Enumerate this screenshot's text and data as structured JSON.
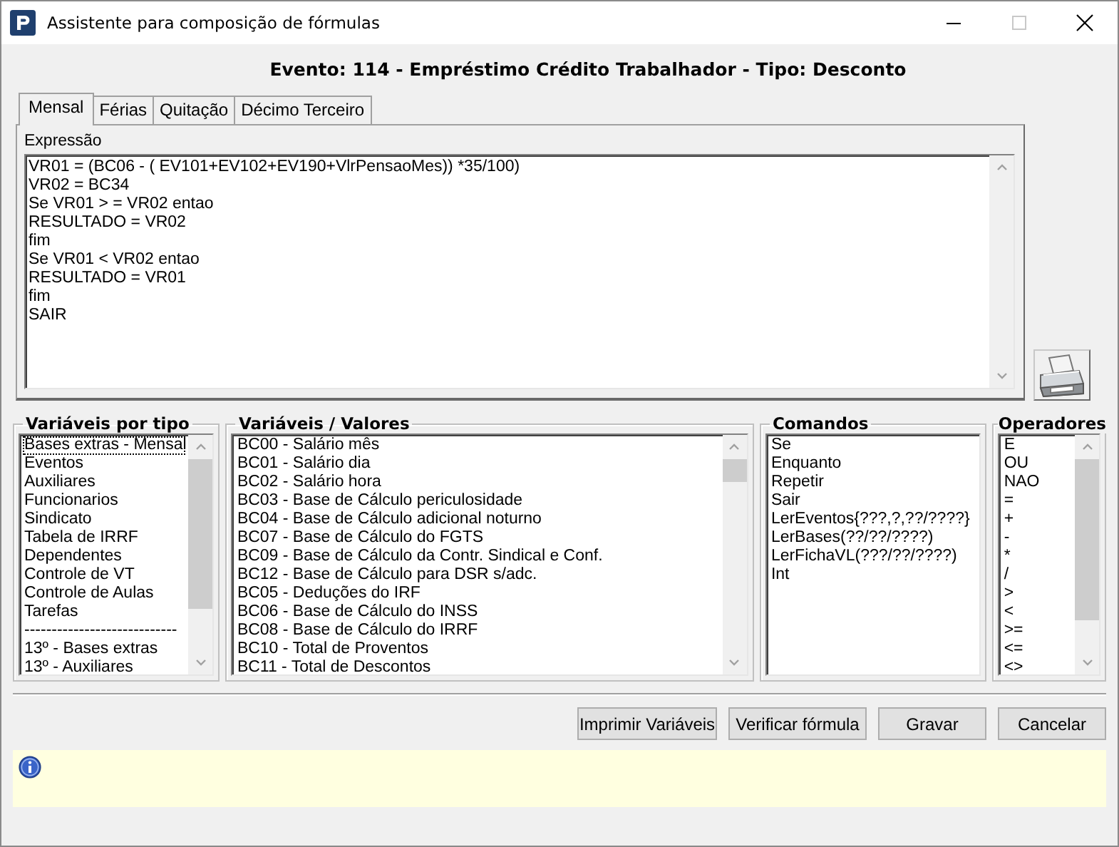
{
  "window": {
    "title": "Assistente para composição de fórmulas"
  },
  "header": "Evento: 114 - Empréstimo Crédito Trabalhador - Tipo: Desconto",
  "tabs": [
    {
      "label": "Mensal",
      "selected": true
    },
    {
      "label": "Férias",
      "selected": false
    },
    {
      "label": "Quitação",
      "selected": false
    },
    {
      "label": "Décimo Terceiro",
      "selected": false
    }
  ],
  "expression": {
    "label": "Expressão",
    "lines": [
      "VR01 = (BC06 - ( EV101+EV102+EV190+VlrPensaoMes)) *35/100)",
      "VR02 = BC34",
      "Se VR01 > = VR02 entao",
      "RESULTADO = VR02",
      "fim",
      "Se VR01 < VR02 entao",
      "RESULTADO = VR01",
      "fim",
      "SAIR"
    ]
  },
  "lists": [
    {
      "title": "Variáveis por tipo",
      "items": [
        {
          "label": "Bases extras - Mensal",
          "selected": true
        },
        {
          "label": "Eventos",
          "selected": false
        },
        {
          "label": "Auxiliares",
          "selected": false
        },
        {
          "label": "Funcionarios",
          "selected": false
        },
        {
          "label": "Sindicato",
          "selected": false
        },
        {
          "label": "Tabela de IRRF",
          "selected": false
        },
        {
          "label": "Dependentes",
          "selected": false
        },
        {
          "label": "Controle de VT",
          "selected": false
        },
        {
          "label": "Controle de Aulas",
          "selected": false
        },
        {
          "label": "Tarefas",
          "selected": false
        },
        {
          "label": "----------------------------",
          "selected": false
        },
        {
          "label": "13º - Bases extras",
          "selected": false
        },
        {
          "label": "13º - Auxiliares",
          "selected": false
        }
      ]
    },
    {
      "title": "Variáveis / Valores",
      "items": [
        {
          "label": "BC00 - Salário mês",
          "selected": false
        },
        {
          "label": "BC01 - Salário dia",
          "selected": false
        },
        {
          "label": "BC02 - Salário hora",
          "selected": false
        },
        {
          "label": "BC03 - Base de Cálculo periculosidade",
          "selected": false
        },
        {
          "label": "BC04 - Base de Cálculo adicional noturno",
          "selected": false
        },
        {
          "label": "BC07 - Base de Cálculo do FGTS",
          "selected": false
        },
        {
          "label": "BC09 - Base de Cálculo da Contr. Sindical e Conf.",
          "selected": false
        },
        {
          "label": "BC12 - Base de Cálculo para DSR s/adc.",
          "selected": false
        },
        {
          "label": "BC05 - Deduções do IRF",
          "selected": false
        },
        {
          "label": "BC06 - Base de Cálculo do INSS",
          "selected": false
        },
        {
          "label": "BC08 - Base de Cálculo do IRRF",
          "selected": false
        },
        {
          "label": "BC10 - Total de Proventos",
          "selected": false
        },
        {
          "label": "BC11 - Total de Descontos",
          "selected": false
        }
      ]
    },
    {
      "title": "Comandos",
      "items": [
        {
          "label": "Se",
          "selected": false
        },
        {
          "label": "Enquanto",
          "selected": false
        },
        {
          "label": "Repetir",
          "selected": false
        },
        {
          "label": "Sair",
          "selected": false
        },
        {
          "label": "LerEventos{???,?,??/????}",
          "selected": false
        },
        {
          "label": "LerBases(??/??/????)",
          "selected": false
        },
        {
          "label": "LerFichaVL(???/??/????)",
          "selected": false
        },
        {
          "label": "Int",
          "selected": false
        }
      ]
    },
    {
      "title": "Operadores",
      "items": [
        {
          "label": "E",
          "selected": false
        },
        {
          "label": "OU",
          "selected": false
        },
        {
          "label": "NAO",
          "selected": false
        },
        {
          "label": "=",
          "selected": false
        },
        {
          "label": "+",
          "selected": false
        },
        {
          "label": "-",
          "selected": false
        },
        {
          "label": "*",
          "selected": false
        },
        {
          "label": "/",
          "selected": false
        },
        {
          "label": ">",
          "selected": false
        },
        {
          "label": "<",
          "selected": false
        },
        {
          "label": ">=",
          "selected": false
        },
        {
          "label": "<=",
          "selected": false
        },
        {
          "label": "<>",
          "selected": false
        }
      ]
    }
  ],
  "buttons": [
    "Imprimir Variáveis",
    "Verificar fórmula",
    "Gravar",
    "Cancelar"
  ]
}
